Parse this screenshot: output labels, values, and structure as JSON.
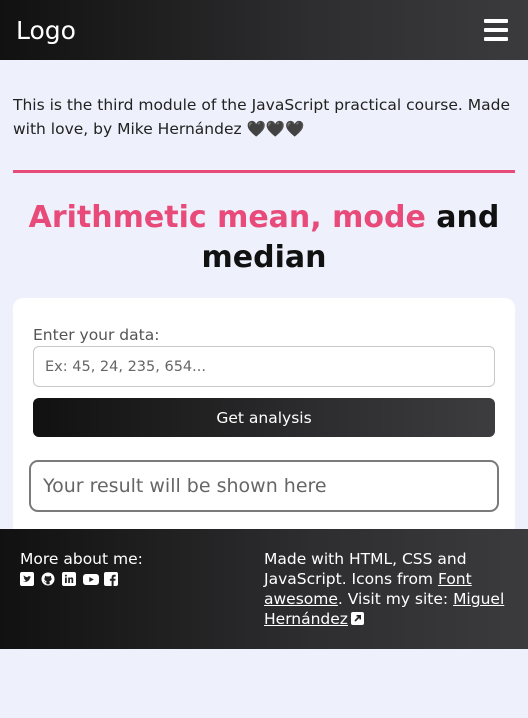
{
  "header": {
    "logo": "Logo"
  },
  "intro": {
    "text": "This is the third module of the JavaScript practical course. Made with love, by Mike Hernández 🖤🖤🖤"
  },
  "title": {
    "pink": "Arithmetic mean, mode",
    "dark": "and median"
  },
  "form": {
    "label": "Enter your data:",
    "placeholder": "Ex: 45, 24, 235, 654...",
    "button": "Get analysis",
    "result": "Your result will be shown here"
  },
  "footer": {
    "about": "More about me:",
    "social": [
      "twitter-icon",
      "github-icon",
      "linkedin-icon",
      "youtube-icon",
      "facebook-icon"
    ],
    "made_prefix": "Made with HTML, CSS and JavaScript. Icons from ",
    "fa_link": "Font awesome",
    "visit": ". Visit my site: ",
    "site_link": "Miguel Hernández"
  },
  "colors": {
    "accent": "#e84a7a",
    "dark": "#111111",
    "background": "#eef1fb"
  }
}
